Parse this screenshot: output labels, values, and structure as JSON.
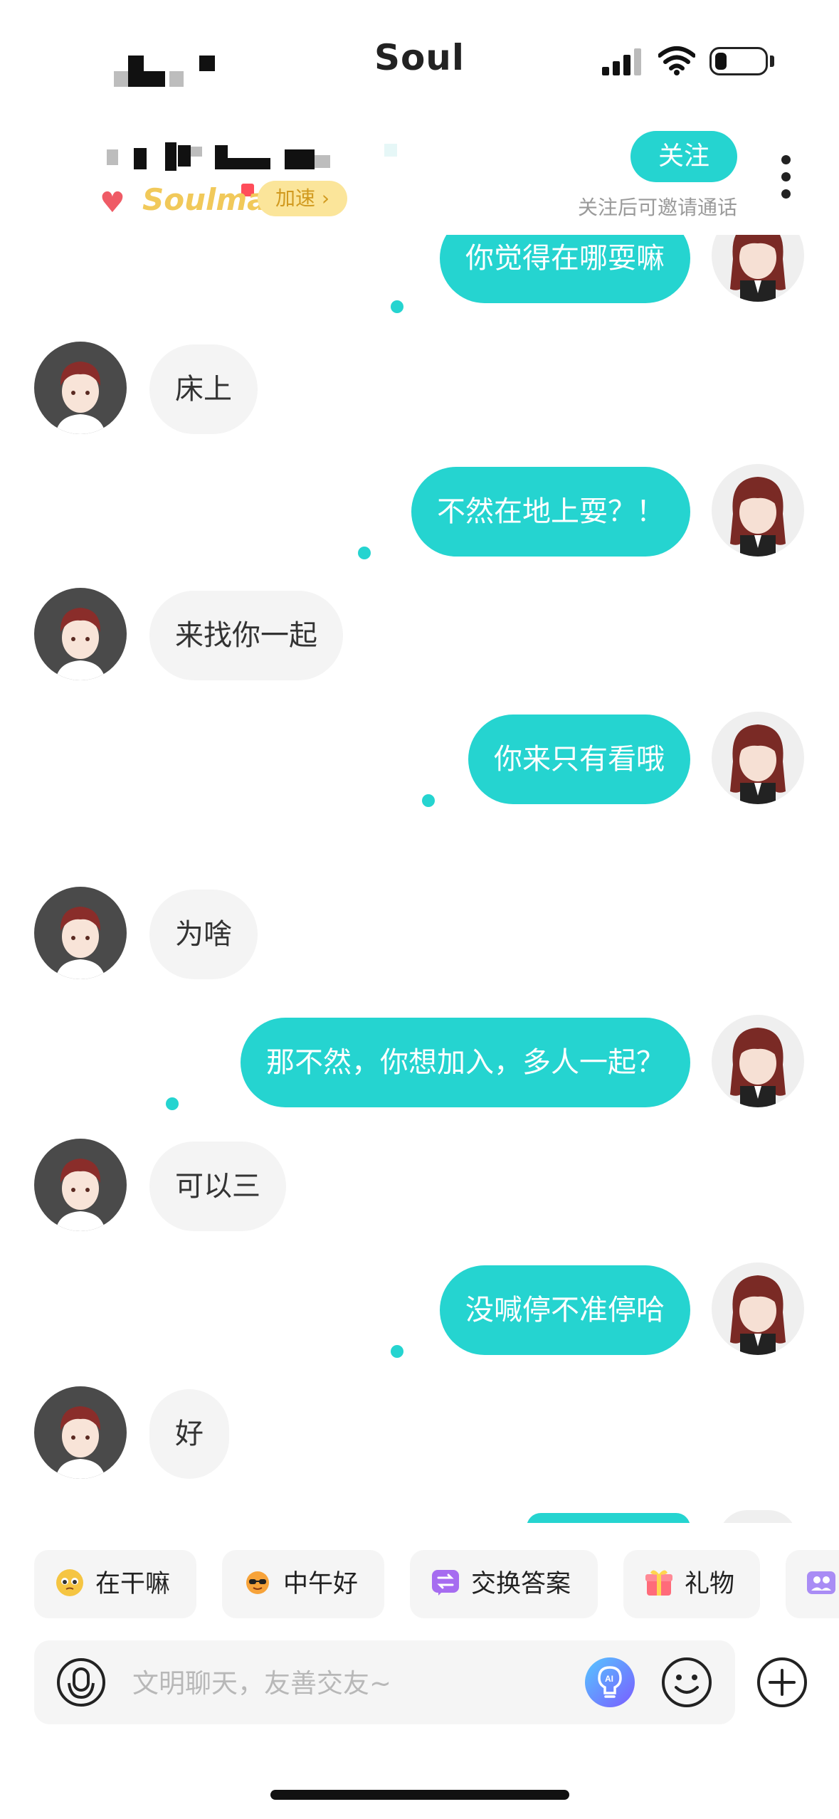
{
  "status_bar": {
    "app_name": "Soul"
  },
  "header": {
    "follow_label": "关注",
    "follow_hint": "关注后可邀请通话",
    "badge_name": "Soulmate",
    "badge_action": "加速 ›"
  },
  "messages": [
    {
      "side": "sent",
      "text": "你觉得在哪耍嘛"
    },
    {
      "side": "received",
      "text": "床上"
    },
    {
      "side": "sent",
      "text": "不然在地上耍？！"
    },
    {
      "side": "received",
      "text": "来找你一起"
    },
    {
      "side": "sent",
      "text": "你来只有看哦"
    },
    {
      "side": "received",
      "text": "为啥"
    },
    {
      "side": "sent",
      "text": "那不然，你想加入，多人一起？"
    },
    {
      "side": "received",
      "text": "可以三"
    },
    {
      "side": "sent",
      "text": "没喊停不准停哈"
    },
    {
      "side": "received",
      "text": "好"
    }
  ],
  "quick_replies": [
    {
      "label": "在干嘛",
      "icon": "pleading-face-icon"
    },
    {
      "label": "中午好",
      "icon": "sun-sunglasses-icon"
    },
    {
      "label": "交换答案",
      "icon": "swap-icon"
    },
    {
      "label": "礼物",
      "icon": "gift-icon"
    },
    {
      "label": "",
      "icon": "group-icon"
    }
  ],
  "input": {
    "placeholder": "文明聊天，友善交友~"
  },
  "colors": {
    "accent": "#25d4d0",
    "received_bubble": "#f4f4f4",
    "input_bg": "#f5f5f5"
  }
}
